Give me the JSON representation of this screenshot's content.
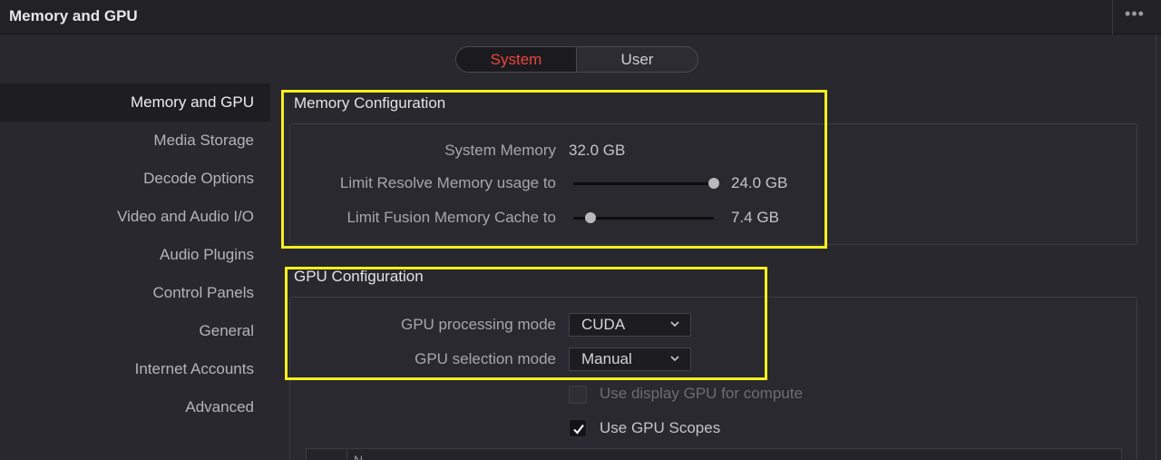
{
  "window": {
    "title": "Memory and GPU",
    "menu_icon": "more-horizontal-icon"
  },
  "tabs": [
    {
      "label": "System",
      "active": true
    },
    {
      "label": "User",
      "active": false
    }
  ],
  "sidebar": {
    "items": [
      {
        "label": "Memory and GPU",
        "active": true
      },
      {
        "label": "Media Storage"
      },
      {
        "label": "Decode Options"
      },
      {
        "label": "Video and Audio I/O"
      },
      {
        "label": "Audio Plugins"
      },
      {
        "label": "Control Panels"
      },
      {
        "label": "General"
      },
      {
        "label": "Internet Accounts"
      },
      {
        "label": "Advanced"
      }
    ]
  },
  "memory": {
    "title": "Memory Configuration",
    "system_memory_label": "System Memory",
    "system_memory_value": "32.0 GB",
    "resolve_limit_label": "Limit Resolve Memory usage to",
    "resolve_limit_value": "24.0 GB",
    "resolve_limit_fraction": 1.0,
    "fusion_cache_label": "Limit Fusion Memory Cache to",
    "fusion_cache_value": "7.4 GB",
    "fusion_cache_fraction": 0.12
  },
  "gpu": {
    "title": "GPU Configuration",
    "processing_mode_label": "GPU processing mode",
    "processing_mode_value": "CUDA",
    "selection_mode_label": "GPU selection mode",
    "selection_mode_value": "Manual",
    "display_gpu_label": "Use display GPU for compute",
    "display_gpu_checked": false,
    "display_gpu_enabled": false,
    "gpu_scopes_label": "Use GPU Scopes",
    "gpu_scopes_checked": true,
    "table_header": "N"
  },
  "colors": {
    "highlight": "#f7f01c",
    "active_tab": "#e8463c"
  }
}
